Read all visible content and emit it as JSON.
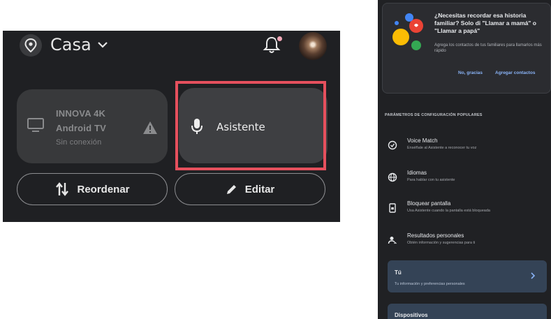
{
  "home": {
    "name": "Casa",
    "icons": {
      "place": "place-pin-icon",
      "dropdown": "chevron-down-icon",
      "notifications": "bell-icon",
      "profile": "avatar"
    },
    "devices": [
      {
        "name": "INNOVA 4K",
        "type": "Android TV",
        "status": "Sin conexión",
        "icon": "tv-icon",
        "status_icon": "warning-icon"
      },
      {
        "name": "Asistente",
        "icon": "mic-icon",
        "highlight_color": "#e5505d"
      }
    ],
    "actions": {
      "reorder": "Reordenar",
      "edit": "Editar"
    }
  },
  "settings": {
    "promo": {
      "title": "¿Necesitas recordar esa historia familiar? Solo di \"Llamar a mamá\" o \"Llamar a papá\"",
      "description": "Agrega los contactos de tus familiares para llamarlos más rápido",
      "dismiss": "No, gracias",
      "confirm": "Agregar contactos"
    },
    "section_title": "PARÁMETROS DE CONFIGURACIÓN POPULARES",
    "items": [
      {
        "title": "Voice Match",
        "subtitle": "Enséñale al Asistente a reconocer tu voz",
        "icon": "voice-match-icon"
      },
      {
        "title": "Idiomas",
        "subtitle": "Para hablar con tu asistente",
        "icon": "globe-icon"
      },
      {
        "title": "Bloquear pantalla",
        "subtitle": "Usa Asistente cuando la pantalla está bloqueada",
        "icon": "lock-screen-icon"
      },
      {
        "title": "Resultados personales",
        "subtitle": "Obtén información y sugerencias para ti",
        "icon": "personal-results-icon"
      }
    ],
    "nav": [
      {
        "title": "Tú",
        "subtitle": "Tu información y preferencias personales"
      },
      {
        "title": "Dispositivos"
      }
    ]
  },
  "colors": {
    "accent_blue": "#8ab4f8",
    "highlight_red": "#e5505d",
    "card_blue": "#344356"
  }
}
